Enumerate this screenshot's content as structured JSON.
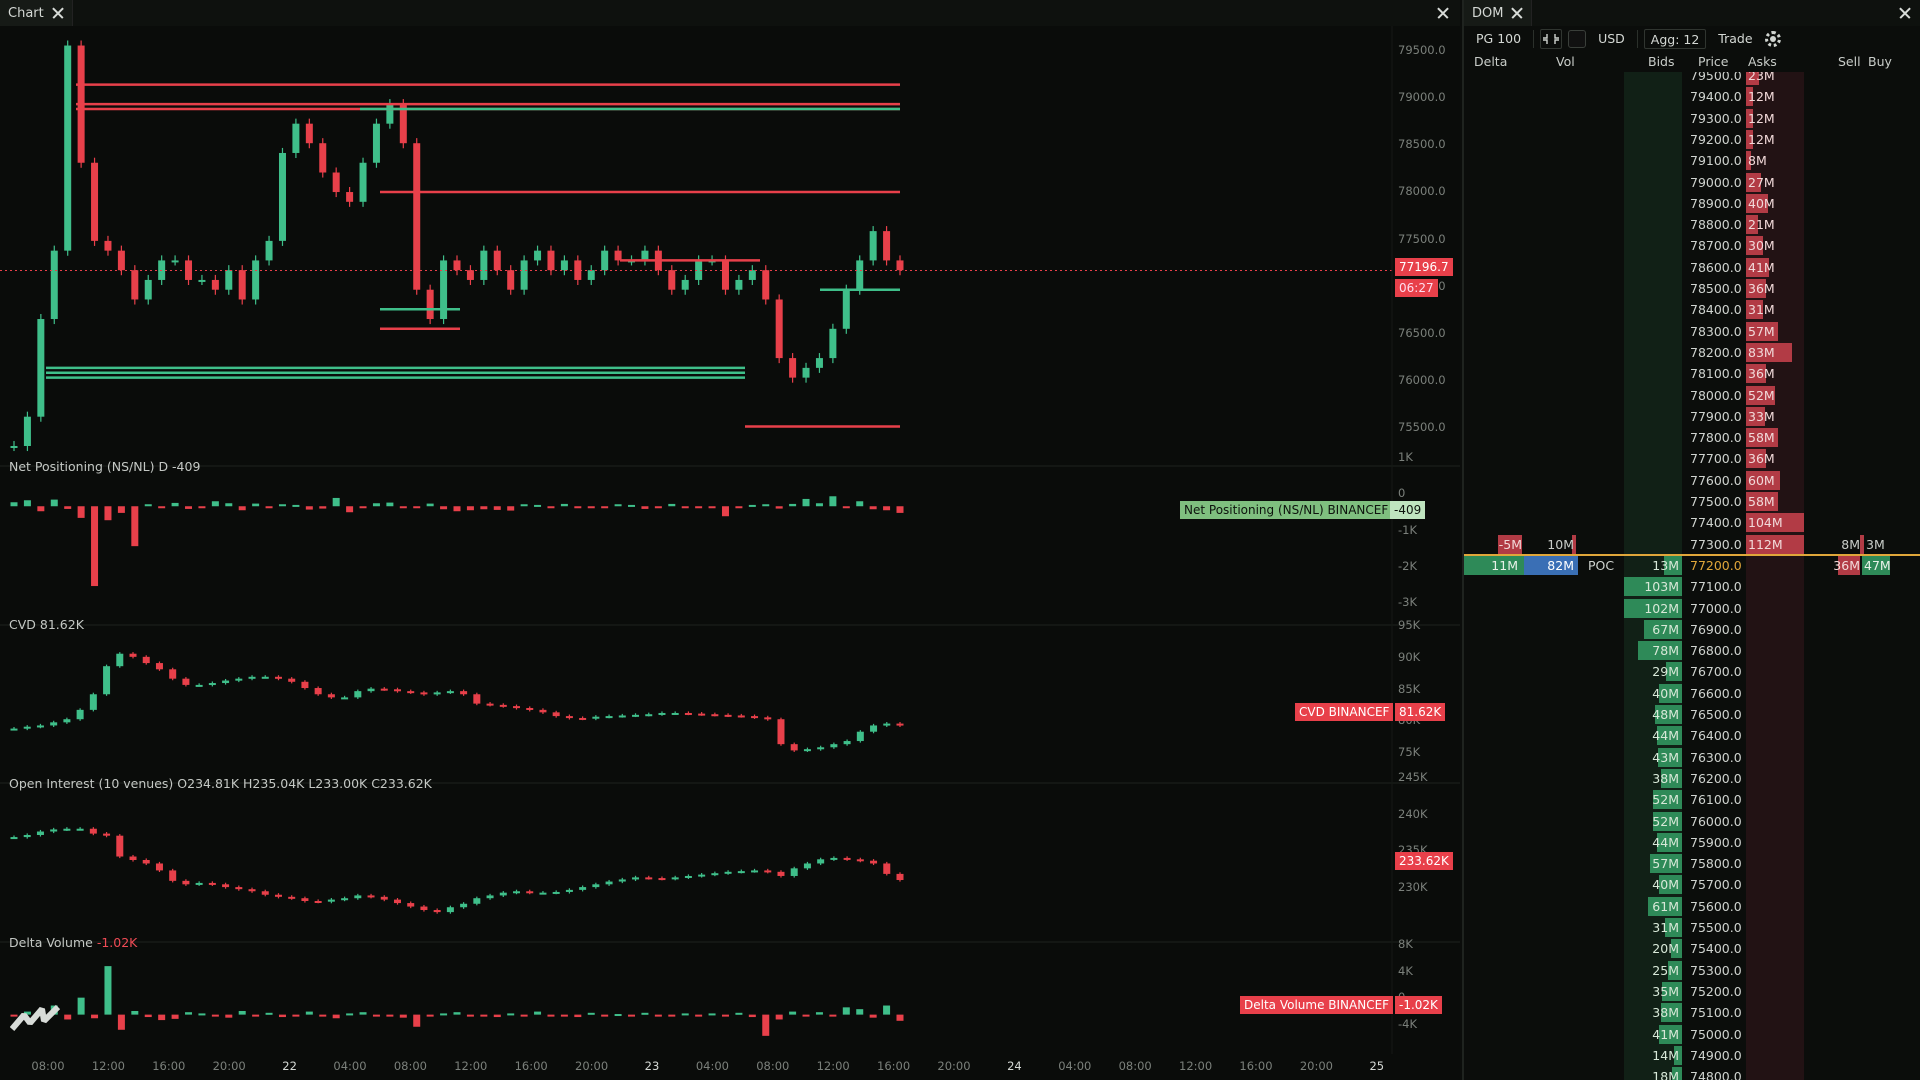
{
  "chart_window": {
    "tab_label": "Chart",
    "panes": {
      "net_positioning": {
        "label": "Net Positioning (NS/NL)",
        "value": "D -409",
        "tag_label": "Net Positioning (NS/NL) BINANCEF",
        "tag_value": "-409"
      },
      "cvd": {
        "label": "CVD",
        "value": "81.62K",
        "tag_label": "CVD BINANCEF",
        "tag_value": "81.62K"
      },
      "open_interest": {
        "label": "Open Interest (10 venues)",
        "value": "O234.81K  H235.04K  L233.00K  C233.62K",
        "tag_value": "233.62K"
      },
      "delta_volume": {
        "label": "Delta Volume",
        "value": "-1.02K",
        "tag_label": "Delta Volume BINANCEF",
        "tag_value": "-1.02K"
      }
    },
    "price_tag": "77196.7",
    "countdown_tag": "06:27",
    "x_axis": [
      "08:00",
      "12:00",
      "16:00",
      "20:00",
      "22",
      "04:00",
      "08:00",
      "12:00",
      "16:00",
      "20:00",
      "23",
      "04:00",
      "08:00",
      "12:00",
      "16:00",
      "20:00",
      "24",
      "04:00",
      "08:00",
      "12:00",
      "16:00",
      "20:00",
      "25"
    ],
    "price_axis": [
      "79500.0",
      "79000.0",
      "78500.0",
      "78000.0",
      "77500.0",
      "77000.0",
      "76500.0",
      "76000.0",
      "75500.0"
    ],
    "np_axis": [
      "1K",
      "0",
      "-1K",
      "-2K",
      "-3K"
    ],
    "cvd_axis": [
      "95K",
      "90K",
      "85K",
      "80K",
      "75K"
    ],
    "oi_axis": [
      "245K",
      "240K",
      "235K",
      "230K"
    ],
    "dv_axis": [
      "8K",
      "4K",
      "0",
      "-4K"
    ],
    "colors": {
      "up": "#3fbf8a",
      "down": "#e8404a",
      "bg": "#0a0c0a"
    },
    "chart_data": [
      {
        "type": "candlestick",
        "title": "",
        "series": [
          {
            "values": [
              75400,
              75700,
              76700,
              77400,
              79500,
              78300,
              77500,
              77400,
              77200,
              76900,
              77100,
              77300,
              77300,
              77100,
              77100,
              77000,
              77200,
              76900,
              77300,
              77500,
              78400,
              78700,
              78500,
              78200,
              78000,
              77900,
              78300,
              78700,
              78900,
              78500,
              77000,
              76700,
              77300,
              77200,
              77100,
              77400,
              77200,
              77000,
              77300,
              77400,
              77200,
              77300,
              77100,
              77200,
              77400,
              77300,
              77300,
              77400,
              77200,
              77000,
              77100,
              77300,
              77300,
              77000,
              77100,
              77200,
              76900,
              76300,
              76100,
              76200,
              76300,
              76600,
              77000,
              77300,
              77600,
              77300,
              77200
            ]
          }
        ],
        "ylim": [
          75400,
          79700
        ],
        "levels_red": [
          79100,
          78900,
          78850,
          78000,
          77300,
          76600,
          75600
        ],
        "levels_green": [
          78850,
          76200,
          76150,
          76100,
          77000,
          76800
        ]
      },
      {
        "type": "bar",
        "title": "",
        "ylim": [
          -3000,
          1000
        ],
        "values": [
          120,
          180,
          -150,
          200,
          -80,
          -350,
          -2400,
          -420,
          -200,
          -1200,
          60,
          -40,
          100,
          -80,
          -60,
          150,
          90,
          -120,
          80,
          -30,
          60,
          40,
          -100,
          -70,
          250,
          -180,
          -50,
          90,
          110,
          -60,
          -30,
          80,
          -90,
          -150,
          -120,
          -90,
          -110,
          -130,
          60,
          40,
          -60,
          70,
          -40,
          -50,
          -30,
          60,
          40,
          -80,
          -50,
          70,
          -40,
          -60,
          -20,
          -300,
          -60,
          40,
          60,
          -70,
          70,
          220,
          90,
          300,
          -30,
          150,
          -90,
          -120,
          -200
        ]
      },
      {
        "type": "candlestick",
        "title": "",
        "ylim": [
          75000,
          96000
        ],
        "series": [
          {
            "values": [
              81000,
              81300,
              81500,
              82000,
              82500,
              84000,
              86500,
              91000,
              93000,
              92500,
              91500,
              90500,
              89000,
              88000,
              88000,
              88300,
              88700,
              89000,
              89300,
              89300,
              89000,
              88500,
              87500,
              86500,
              86000,
              86000,
              87000,
              87400,
              87300,
              87000,
              86800,
              86500,
              86800,
              87000,
              86500,
              85000,
              84800,
              84600,
              84300,
              84000,
              83600,
              83000,
              82700,
              82600,
              82900,
              83000,
              83100,
              83200,
              83300,
              83500,
              83500,
              83400,
              83300,
              83200,
              83100,
              83000,
              82800,
              82500,
              78500,
              77500,
              77700,
              78000,
              78500,
              79000,
              80500,
              81500,
              81800,
              81500
            ]
          }
        ]
      },
      {
        "type": "candlestick",
        "title": "",
        "ylim": [
          227000,
          246000
        ],
        "series": [
          {
            "values": [
              239800,
              240100,
              240600,
              240900,
              241000,
              241000,
              240300,
              240000,
              237000,
              236500,
              236000,
              235000,
              233500,
              233000,
              233200,
              233000,
              232600,
              232300,
              232000,
              231500,
              231200,
              231000,
              230600,
              230500,
              230800,
              231000,
              231400,
              231200,
              230800,
              230300,
              229800,
              229300,
              229000,
              229700,
              230200,
              231000,
              231400,
              231800,
              232000,
              231800,
              231800,
              231900,
              232200,
              232600,
              233000,
              233400,
              233700,
              234000,
              233900,
              233800,
              234000,
              234200,
              234400,
              234600,
              234800,
              234900,
              235000,
              234800,
              234200,
              235300,
              236000,
              236600,
              236800,
              236600,
              236400,
              236000,
              234500,
              233620
            ]
          }
        ]
      },
      {
        "type": "bar",
        "title": "",
        "ylim": [
          -6000,
          10000
        ],
        "values": [
          -300,
          500,
          800,
          1500,
          -800,
          2800,
          -600,
          8000,
          -2500,
          600,
          -400,
          -900,
          -700,
          400,
          200,
          -300,
          -500,
          600,
          -200,
          300,
          -400,
          -200,
          500,
          -300,
          -600,
          200,
          400,
          -300,
          -200,
          -500,
          -2000,
          -300,
          200,
          400,
          -300,
          -200,
          -400,
          200,
          -300,
          500,
          -200,
          -300,
          -400,
          300,
          -200,
          100,
          -200,
          300,
          -200,
          -300,
          200,
          -300,
          200,
          -200,
          300,
          -400,
          -3500,
          -800,
          500,
          -300,
          400,
          -200,
          1200,
          900,
          -500,
          1500,
          -1020
        ]
      }
    ]
  },
  "dom_window": {
    "tab_label": "DOM",
    "toolbar": {
      "pg": "PG 100",
      "currency": "USD",
      "agg": "Agg: 12",
      "trade": "Trade"
    },
    "headers": {
      "delta": "Delta",
      "vol": "Vol",
      "bids": "Bids",
      "price": "Price",
      "asks": "Asks",
      "sell": "Sell",
      "buy": "Buy"
    },
    "poc_label": "POC",
    "ask_rows": [
      {
        "price": "79500.0",
        "ask": "23M",
        "w": 0.22
      },
      {
        "price": "79400.0",
        "ask": "12M",
        "w": 0.12
      },
      {
        "price": "79300.0",
        "ask": "12M",
        "w": 0.12
      },
      {
        "price": "79200.0",
        "ask": "12M",
        "w": 0.12
      },
      {
        "price": "79100.0",
        "ask": "8M",
        "w": 0.08
      },
      {
        "price": "79000.0",
        "ask": "27M",
        "w": 0.26
      },
      {
        "price": "78900.0",
        "ask": "40M",
        "w": 0.38
      },
      {
        "price": "78800.0",
        "ask": "21M",
        "w": 0.2
      },
      {
        "price": "78700.0",
        "ask": "30M",
        "w": 0.29
      },
      {
        "price": "78600.0",
        "ask": "41M",
        "w": 0.39
      },
      {
        "price": "78500.0",
        "ask": "36M",
        "w": 0.35
      },
      {
        "price": "78400.0",
        "ask": "31M",
        "w": 0.3
      },
      {
        "price": "78300.0",
        "ask": "57M",
        "w": 0.55
      },
      {
        "price": "78200.0",
        "ask": "83M",
        "w": 0.8
      },
      {
        "price": "78100.0",
        "ask": "36M",
        "w": 0.35
      },
      {
        "price": "78000.0",
        "ask": "52M",
        "w": 0.5
      },
      {
        "price": "77900.0",
        "ask": "33M",
        "w": 0.32
      },
      {
        "price": "77800.0",
        "ask": "58M",
        "w": 0.56
      },
      {
        "price": "77700.0",
        "ask": "36M",
        "w": 0.35
      },
      {
        "price": "77600.0",
        "ask": "60M",
        "w": 0.58
      },
      {
        "price": "77500.0",
        "ask": "58M",
        "w": 0.56
      },
      {
        "price": "77400.0",
        "ask": "104M",
        "w": 1.0
      },
      {
        "price": "77300.0",
        "ask": "112M",
        "w": 1.0
      }
    ],
    "row_77300_extra": {
      "delta": "-5M",
      "vol": "10M",
      "sell": "8M",
      "buy": "3M"
    },
    "current_row": {
      "delta": "11M",
      "vol": "82M",
      "bid": "13M",
      "price": "77200.0",
      "sell": "36M",
      "buy": "47M"
    },
    "bid_rows": [
      {
        "price": "77100.0",
        "bid": "103M",
        "w": 1.0
      },
      {
        "price": "77000.0",
        "bid": "102M",
        "w": 1.0
      },
      {
        "price": "76900.0",
        "bid": "67M",
        "w": 0.65
      },
      {
        "price": "76800.0",
        "bid": "78M",
        "w": 0.76
      },
      {
        "price": "76700.0",
        "bid": "29M",
        "w": 0.28
      },
      {
        "price": "76600.0",
        "bid": "40M",
        "w": 0.39
      },
      {
        "price": "76500.0",
        "bid": "48M",
        "w": 0.47
      },
      {
        "price": "76400.0",
        "bid": "44M",
        "w": 0.43
      },
      {
        "price": "76300.0",
        "bid": "43M",
        "w": 0.42
      },
      {
        "price": "76200.0",
        "bid": "38M",
        "w": 0.37
      },
      {
        "price": "76100.0",
        "bid": "52M",
        "w": 0.5
      },
      {
        "price": "76000.0",
        "bid": "52M",
        "w": 0.5
      },
      {
        "price": "75900.0",
        "bid": "44M",
        "w": 0.43
      },
      {
        "price": "75800.0",
        "bid": "57M",
        "w": 0.55
      },
      {
        "price": "75700.0",
        "bid": "40M",
        "w": 0.39
      },
      {
        "price": "75600.0",
        "bid": "61M",
        "w": 0.59
      },
      {
        "price": "75500.0",
        "bid": "31M",
        "w": 0.3
      },
      {
        "price": "75400.0",
        "bid": "20M",
        "w": 0.19
      },
      {
        "price": "75300.0",
        "bid": "25M",
        "w": 0.24
      },
      {
        "price": "75200.0",
        "bid": "35M",
        "w": 0.34
      },
      {
        "price": "75100.0",
        "bid": "38M",
        "w": 0.37
      },
      {
        "price": "75000.0",
        "bid": "41M",
        "w": 0.4
      },
      {
        "price": "74900.0",
        "bid": "14M",
        "w": 0.14
      },
      {
        "price": "74800.0",
        "bid": "18M",
        "w": 0.17
      }
    ]
  }
}
